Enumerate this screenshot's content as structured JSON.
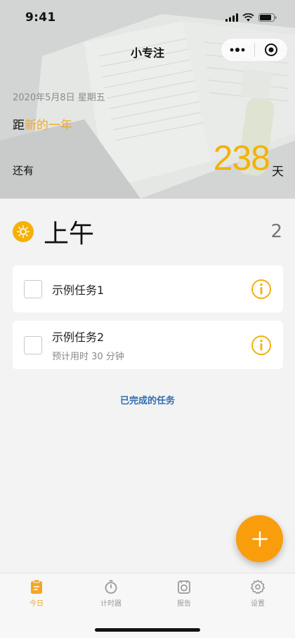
{
  "status_bar": {
    "time": "9:41"
  },
  "nav": {
    "title": "小专注"
  },
  "hero": {
    "date": "2020年5月8日 星期五",
    "distance_prefix": "距",
    "distance_target": "新的一年",
    "remaining_label": "还有",
    "count": "238",
    "unit": "天"
  },
  "section": {
    "title": "上午",
    "count": "2"
  },
  "tasks": [
    {
      "name": "示例任务1",
      "sub": ""
    },
    {
      "name": "示例任务2",
      "sub": "预计用时 30 分钟"
    }
  ],
  "completed_link": "已完成的任务",
  "tabs": [
    {
      "label": "今日",
      "icon": "clipboard-icon",
      "active": true
    },
    {
      "label": "计时器",
      "icon": "stopwatch-icon",
      "active": false
    },
    {
      "label": "报告",
      "icon": "report-icon",
      "active": false
    },
    {
      "label": "设置",
      "icon": "gear-icon",
      "active": false
    }
  ],
  "colors": {
    "accent": "#f5a623",
    "count": "#f5b10a",
    "fab": "#f99d0c",
    "link": "#2f6db3"
  }
}
